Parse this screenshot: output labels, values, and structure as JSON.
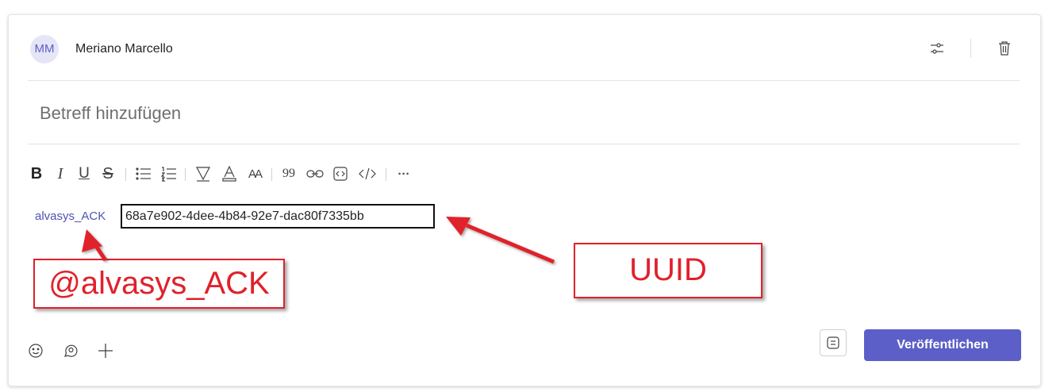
{
  "post": {
    "avatar_initials": "MM",
    "author": "Meriano Marcello",
    "subject_placeholder": "Betreff hinzufügen",
    "mention": "alvasys_ACK",
    "uuid": "68a7e902-4dee-4b84-92e7-dac80f7335bb",
    "publish_label": "Veröffentlichen"
  },
  "toolbar": {
    "bold": "B",
    "italic": "I",
    "underline": "U",
    "strike": "S",
    "font_size": "AA",
    "quote": "99",
    "more": "···"
  },
  "header_icons": [
    "settings-sliders-icon",
    "trash-icon"
  ],
  "bottom_icons": [
    "emoji-icon",
    "sticker-icon",
    "plus-icon"
  ],
  "annotations": {
    "mention_label": "@alvasys_ACK",
    "uuid_label": "UUID"
  },
  "colors": {
    "accent": "#5b5fc7",
    "annotation_red": "#e0212b"
  }
}
